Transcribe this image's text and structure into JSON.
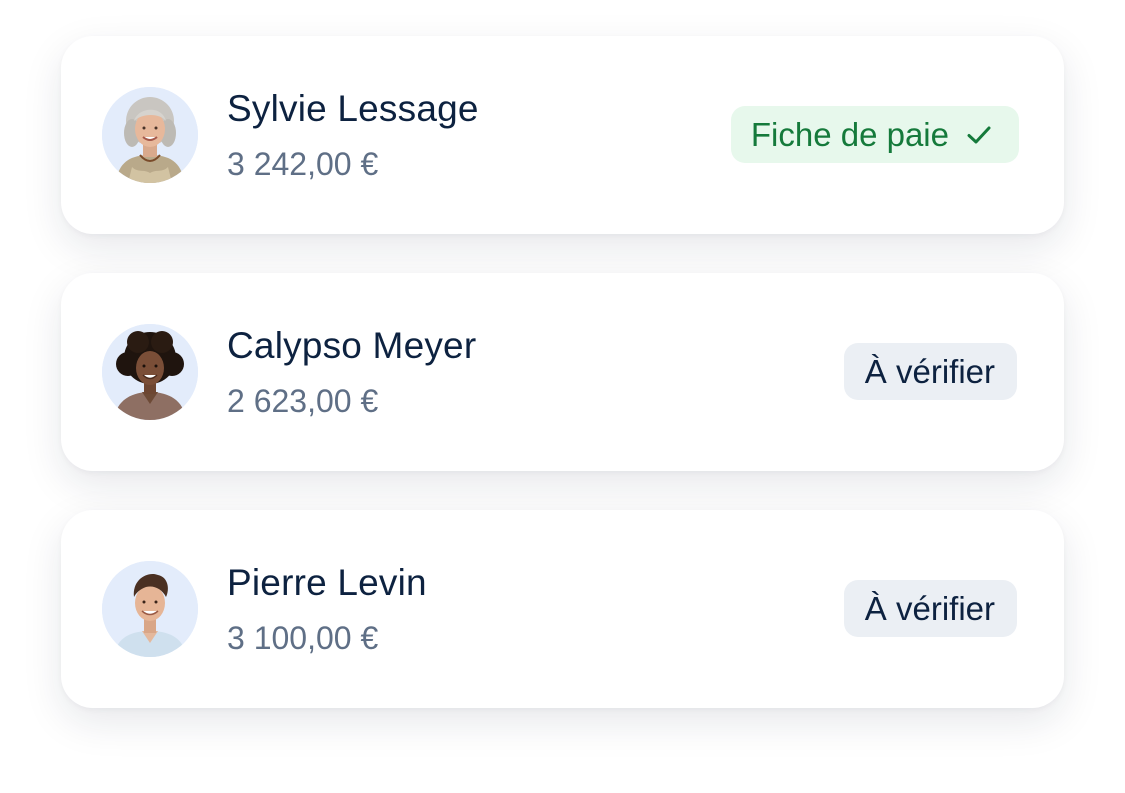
{
  "employees": [
    {
      "name": "Sylvie Lessage",
      "amount": "3 242,00 €",
      "status_label": "Fiche de paie",
      "status": "done",
      "status_icon": "check-icon",
      "status_color": "#157a3b",
      "status_bg": "#e7f8ec"
    },
    {
      "name": "Calypso Meyer",
      "amount": "2 623,00 €",
      "status_label": "À vérifier",
      "status": "pending",
      "status_color": "#0d2240",
      "status_bg": "#ebeff4"
    },
    {
      "name": "Pierre Levin",
      "amount": "3 100,00 €",
      "status_label": "À vérifier",
      "status": "pending",
      "status_color": "#0d2240",
      "status_bg": "#ebeff4"
    }
  ]
}
